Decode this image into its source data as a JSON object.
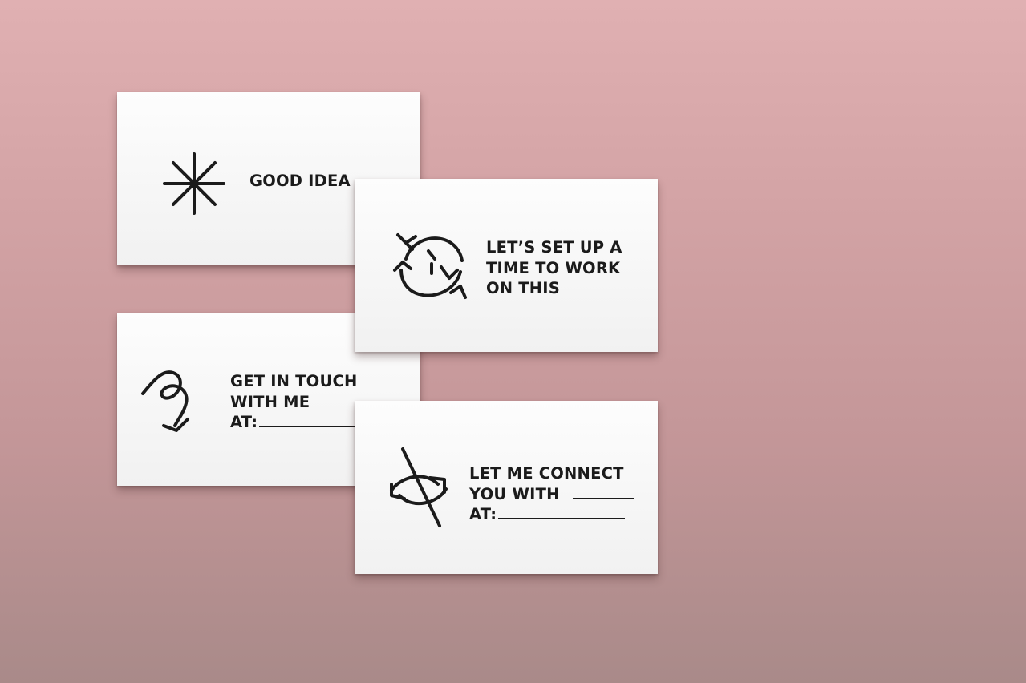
{
  "cards": [
    {
      "icon": "asterisk-star-icon",
      "lines": [
        "GOOD IDEA"
      ]
    },
    {
      "icon": "cycle-arrows-clock-icon",
      "lines": [
        "LET’S SET UP A",
        "TIME TO WORK",
        "ON THIS"
      ]
    },
    {
      "icon": "loop-arrow-icon",
      "lines": [
        "GET IN TOUCH",
        "WITH ME",
        "AT:"
      ]
    },
    {
      "icon": "crossing-arrows-icon",
      "lines": [
        "LET ME CONNECT",
        "YOU WITH",
        "AT:"
      ]
    }
  ]
}
